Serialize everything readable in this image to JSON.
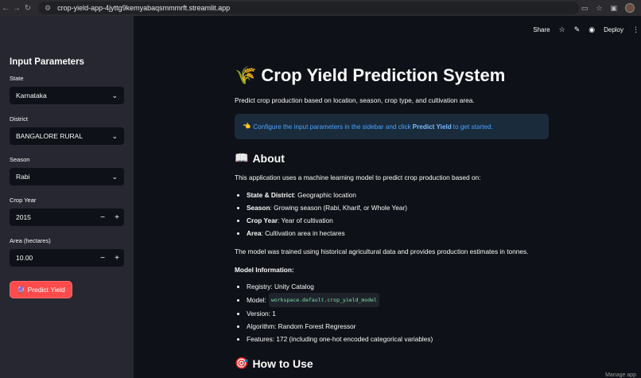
{
  "browser": {
    "url": "crop-yield-app-4jyttg9kemyabaqsmmmrft.streamlit.app"
  },
  "toolbar": {
    "share": "Share",
    "deploy": "Deploy"
  },
  "sidebar": {
    "title": "Input Parameters",
    "state_label": "State",
    "state_value": "Karnataka",
    "district_label": "District",
    "district_value": "BANGALORE RURAL",
    "season_label": "Season",
    "season_value": "Rabi",
    "year_label": "Crop Year",
    "year_value": "2015",
    "area_label": "Area (hectares)",
    "area_value": "10.00",
    "predict_button": "Predict Yield"
  },
  "main": {
    "title": "Crop Yield Prediction System",
    "subtitle": "Predict crop production based on location, season, crop type, and cultivation area.",
    "info_pre": "Configure the input parameters in the sidebar and click ",
    "info_bold": "Predict Yield",
    "info_post": " to get started.",
    "about_heading": "About",
    "about_intro": "This application uses a machine learning model to predict crop production based on:",
    "bullets": [
      {
        "bold": "State & District",
        "text": ": Geographic location"
      },
      {
        "bold": "Season",
        "text": ": Growing season (Rabi, Kharif, or Whole Year)"
      },
      {
        "bold": "Crop Year",
        "text": ": Year of cultivation"
      },
      {
        "bold": "Area",
        "text": ": Cultivation area in hectares"
      }
    ],
    "trained_text": "The model was trained using historical agricultural data and provides production estimates in tonnes.",
    "model_info_heading": "Model Information:",
    "model_info": {
      "registry": "Registry: Unity Catalog",
      "model_label": "Model:",
      "model_code": "workspace.default.crop_yield_model",
      "version": "Version: 1",
      "algorithm": "Algorithm: Random Forest Regressor",
      "features": "Features: 172 (including one-hot encoded categorical variables)"
    },
    "howto_heading": "How to Use",
    "manage": "Manage app"
  }
}
